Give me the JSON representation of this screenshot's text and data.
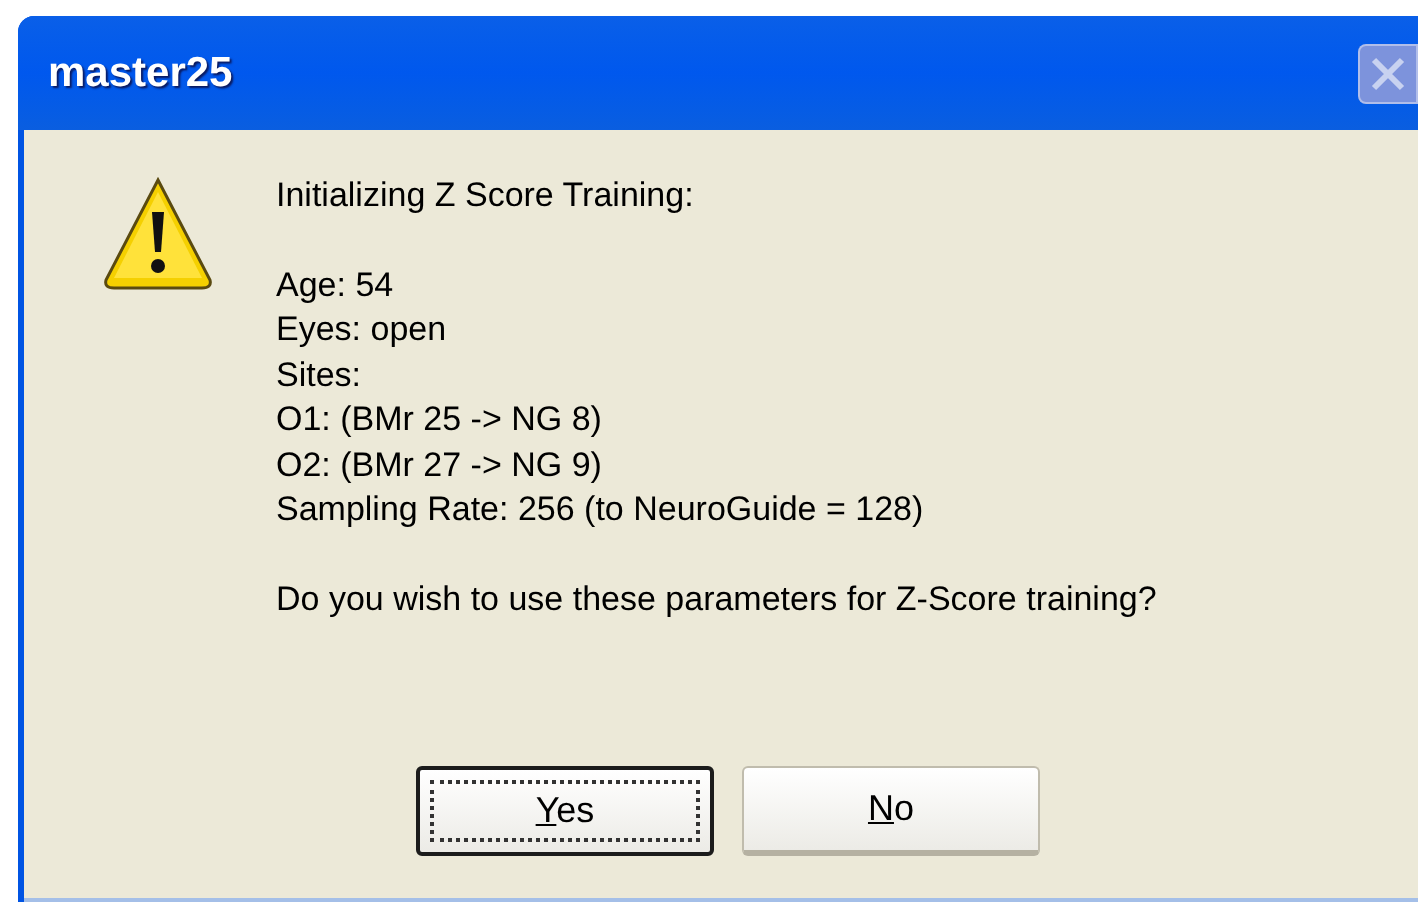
{
  "window": {
    "title": "master25",
    "close_button": {
      "disabled": true
    }
  },
  "message": {
    "kind": "warning",
    "paragraphs": [
      [
        "Initializing Z Score Training:"
      ],
      [
        "Age: 54",
        "Eyes: open",
        "Sites:",
        "O1: (BMr 25 -> NG 8)",
        "O2: (BMr 27 -> NG 9)",
        "Sampling Rate: 256 (to NeuroGuide = 128)"
      ],
      [
        "Do you wish to use these parameters for Z-Score training?"
      ]
    ]
  },
  "buttons": [
    {
      "label": "Yes",
      "default": true
    },
    {
      "label": "No",
      "default": false
    }
  ]
}
